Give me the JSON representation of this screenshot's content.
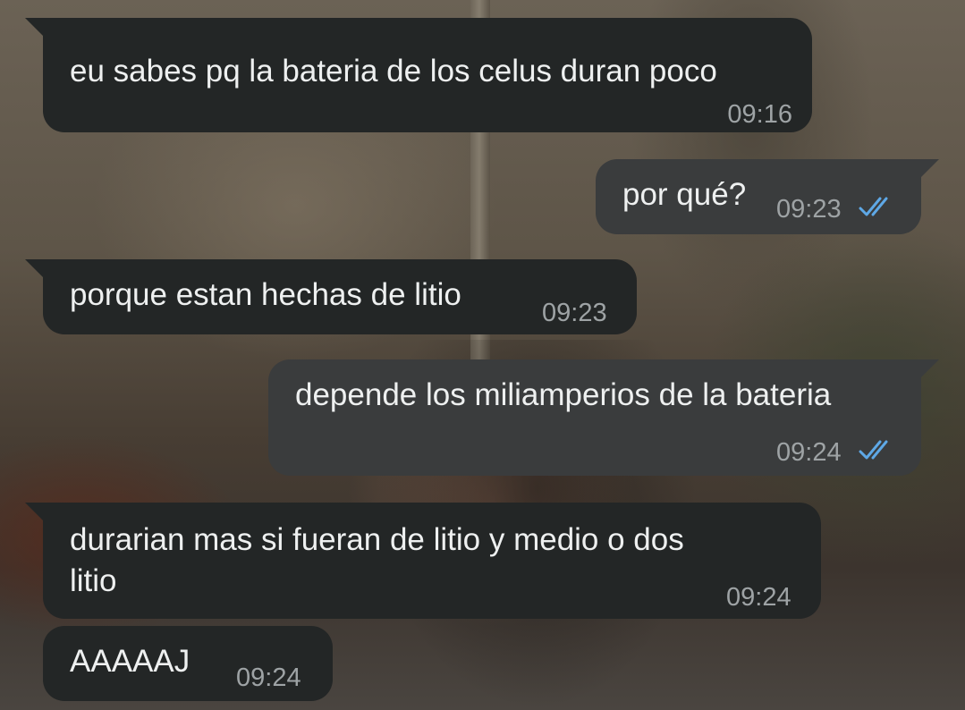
{
  "messages": [
    {
      "direction": "in",
      "text": "eu sabes pq la bateria de los celus duran poco",
      "time": "09:16"
    },
    {
      "direction": "out",
      "text": "por qué?",
      "time": "09:23",
      "status_icon": "double-check-read-icon"
    },
    {
      "direction": "in",
      "text": "porque estan hechas de litio",
      "time": "09:23"
    },
    {
      "direction": "out",
      "text": "depende los miliamperios de la bateria",
      "time": "09:24",
      "status_icon": "double-check-read-icon"
    },
    {
      "direction": "in",
      "lines": [
        "durarian mas si fueran de litio y medio o dos",
        "litio"
      ],
      "time": "09:24"
    },
    {
      "direction": "in",
      "text": "AAAAAJ",
      "time": "09:24"
    }
  ],
  "colors": {
    "incoming_bubble": "#232626",
    "outgoing_bubble": "#3a3c3d",
    "text": "#eef0f0",
    "timestamp": "#9ea3a5",
    "read_ticks": "#5ea8e6"
  }
}
